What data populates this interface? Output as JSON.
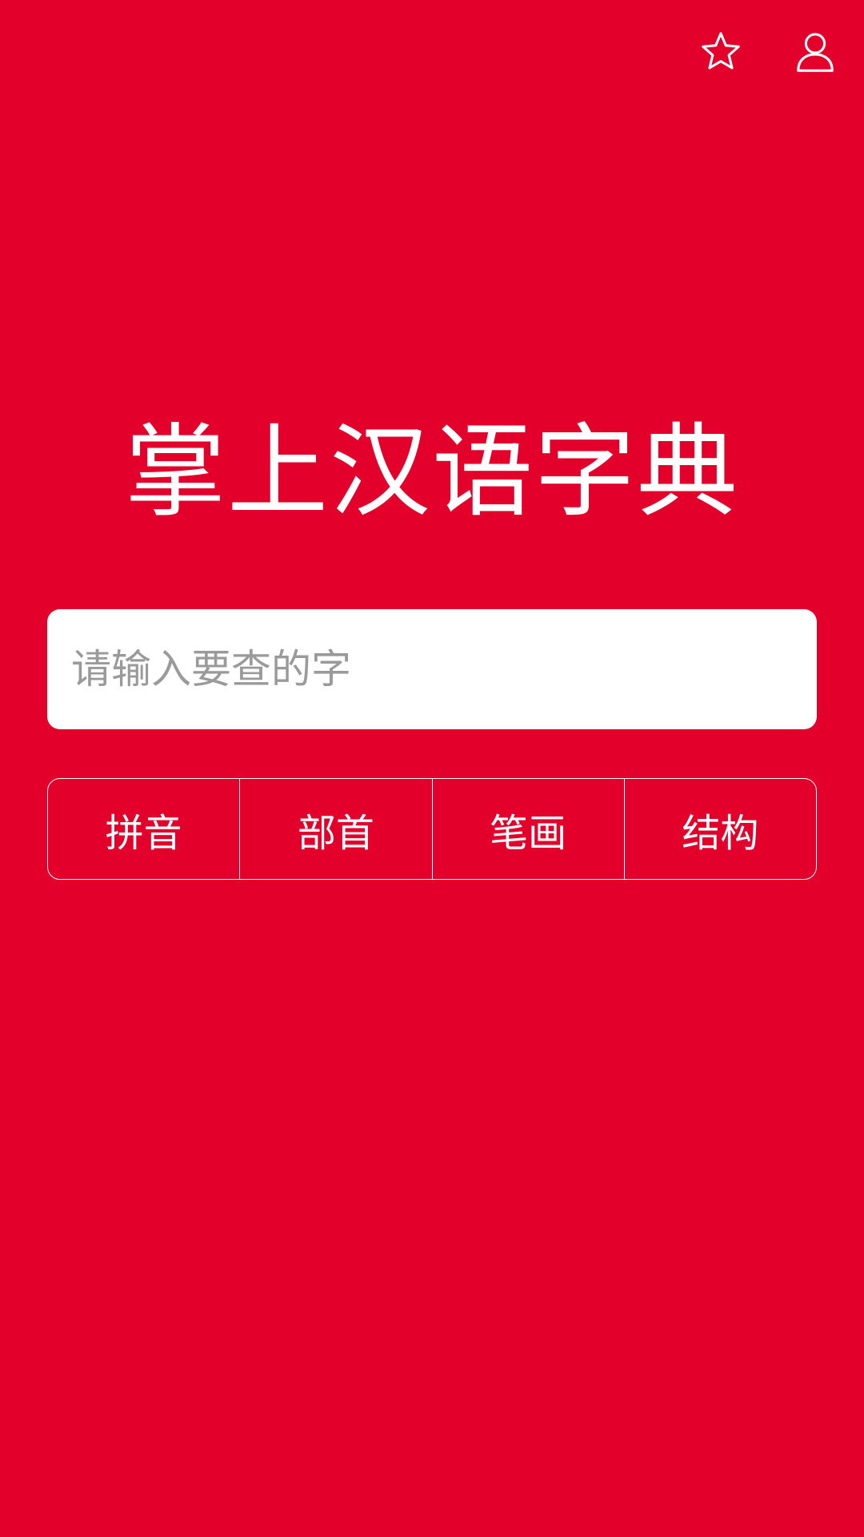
{
  "colors": {
    "background": "#e3002b",
    "foreground": "#ffffff",
    "placeholder": "#9a9a9a"
  },
  "top_bar": {
    "icons": [
      "star-icon",
      "user-icon"
    ]
  },
  "title": "掌上汉语字典",
  "search": {
    "placeholder": "请输入要查的字",
    "value": ""
  },
  "modes": [
    {
      "label": "拼音"
    },
    {
      "label": "部首"
    },
    {
      "label": "笔画"
    },
    {
      "label": "结构"
    }
  ]
}
